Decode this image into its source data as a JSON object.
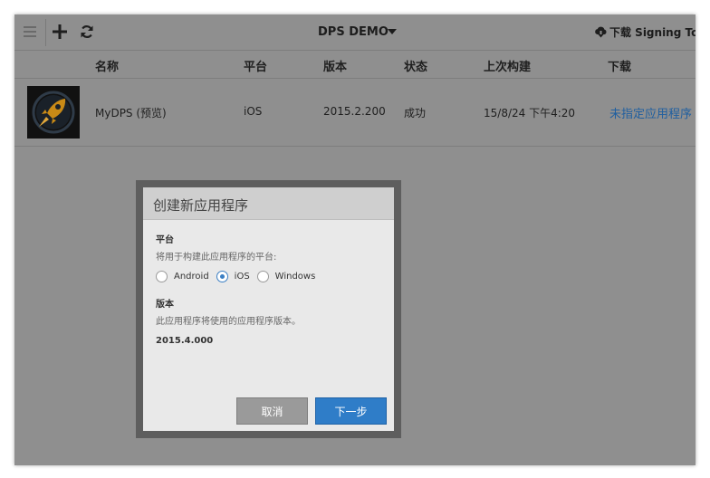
{
  "toolbar": {
    "menu_icon": "hamburger-icon",
    "add_icon": "plus-icon",
    "refresh_icon": "refresh-icon",
    "app_title": "DPS DEMO",
    "download_signing_label": "下载 Signing Tool",
    "download_icon": "cloud-download-icon"
  },
  "table": {
    "headers": [
      "名称",
      "平台",
      "版本",
      "状态",
      "上次构建",
      "下载"
    ],
    "rows": [
      {
        "icon": "rocket-app-icon",
        "name": "MyDPS (预览)",
        "platform": "iOS",
        "version": "2015.2.200",
        "status": "成功",
        "last_build": "15/8/24 下午4:20",
        "download": "未指定应用程序"
      }
    ]
  },
  "dialog": {
    "title": "创建新应用程序",
    "platform_label": "平台",
    "platform_desc": "将用于构建此应用程序的平台:",
    "platform_options": [
      "Android",
      "iOS",
      "Windows"
    ],
    "platform_selected": "iOS",
    "version_label": "版本",
    "version_desc": "此应用程序将使用的应用程序版本。",
    "version_value": "2015.4.000",
    "cancel_label": "取消",
    "next_label": "下一步"
  },
  "colors": {
    "overlay_bg": "#8f8f8f",
    "link": "#1f5fa0",
    "primary_button": "#2f7dc8",
    "dialog_frame": "#5e5e5e"
  }
}
